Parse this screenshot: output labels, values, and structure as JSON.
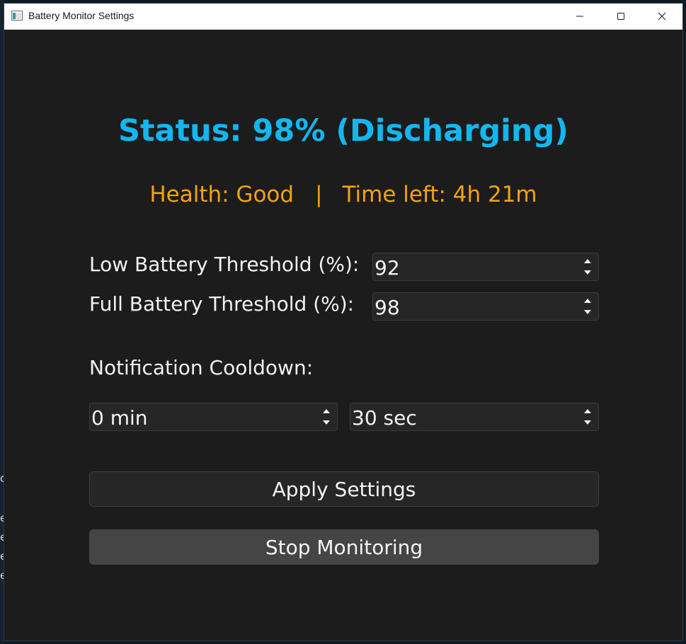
{
  "window": {
    "title": "Battery Monitor Settings",
    "controls": {
      "minimize_icon": "minimize-icon",
      "maximize_icon": "maximize-icon",
      "close_icon": "close-icon"
    }
  },
  "status": {
    "text": "Status: 98% (Discharging)",
    "color": "#12b7f0"
  },
  "info": {
    "health": "Health: Good",
    "separator": "|",
    "time_left": "Time left: 4h 21m",
    "color": "#f2a313"
  },
  "thresholds": {
    "low_label": "Low Battery Threshold (%):",
    "low_value": "92",
    "full_label": "Full Battery Threshold (%):",
    "full_value": "98"
  },
  "cooldown": {
    "label": "Notification Cooldown:",
    "minutes_value": "0 min",
    "seconds_value": "30 sec"
  },
  "buttons": {
    "apply": "Apply Settings",
    "stop": "Stop Monitoring"
  },
  "background_text": [
    "e",
    "e",
    "e",
    "e",
    "o"
  ]
}
